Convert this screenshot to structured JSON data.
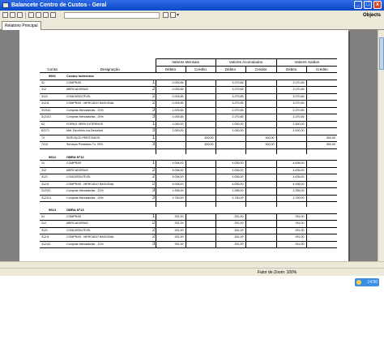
{
  "window": {
    "title": "Balancete Centro de Custos - Geral",
    "minimize": "_",
    "maximize": "□",
    "close": "x"
  },
  "toolbar": {
    "objects_label": "Objects",
    "dropdown_arrow": "▾"
  },
  "tabs": [
    {
      "label": "Relatório Principal"
    }
  ],
  "status": {
    "zoom": "Fator de Zoom: 100%"
  },
  "tray": {
    "time": "14:50"
  },
  "report": {
    "groups": {
      "mensais": "Valores Mensais",
      "acumulados": "Valores Acumulados",
      "saldos": "Valores Saldos"
    },
    "headers": {
      "conta": "Conta",
      "designacao": "Designação",
      "debito1": "Débito",
      "credito1": "Crédito",
      "debito2": "Débito",
      "credito2": "Crédito",
      "debito3": "Débito",
      "credito3": "Crédito"
    },
    "sections": [
      {
        "code": "9901",
        "name": "Custos Indirectos",
        "rows": [
          {
            "conta": "31",
            "desig": "COMPRAS",
            "n": "1",
            "d1": "2.005,65",
            "c1": "",
            "d2": "3.270,65",
            "c2": "",
            "d3": "3.270,65",
            "c3": ""
          },
          {
            "conta": "312",
            "desig": "MERCADORIAS",
            "n": "2",
            "d1": "2.005,65",
            "c1": "",
            "d2": "3.270,65",
            "c2": "",
            "d3": "3.270,65",
            "c3": ""
          },
          {
            "conta": "3121",
            "desig": "C/IVA DEDUTÍVEL",
            "n": "2",
            "d1": "2.005,65",
            "c1": "",
            "d2": "3.270,65",
            "c2": "",
            "d3": "3.270,65",
            "c3": ""
          },
          {
            "conta": "31211",
            "desig": "COMPRAS - MERCADO NACIONAL",
            "n": "2",
            "d1": "2.005,65",
            "c1": "",
            "d2": "3.270,65",
            "c2": "",
            "d3": "3.270,65",
            "c3": ""
          },
          {
            "conta": "312111",
            "desig": "Compras Mercadorias - 21%",
            "n": "3",
            "d1": "1.005,65",
            "c1": "",
            "d2": "2.270,65",
            "c2": "",
            "d3": "2.270,65",
            "c3": ""
          },
          {
            "conta": "312113",
            "desig": "Compras Mercadorias - 20%",
            "n": "3",
            "d1": "1.005,65",
            "c1": "",
            "d2": "2.270,65",
            "c2": "",
            "d3": "2.270,65",
            "c3": ""
          },
          {
            "conta": "62",
            "desig": "FORN E SERV EXTERNOS",
            "n": "1",
            "d1": "1.000,00",
            "c1": "",
            "d2": "1.000,00",
            "c2": "",
            "d3": "1.000,00",
            "c3": ""
          },
          {
            "conta": "62171",
            "desig": "Mat. Escritório-Iva Dedutível",
            "n": "3",
            "d1": "1.000,00",
            "c1": "",
            "d2": "1.000,00",
            "c2": "",
            "d3": "1.000,00",
            "c3": ""
          },
          {
            "conta": "72",
            "desig": "SERVIÇOS PRESTADOS",
            "n": "1",
            "d1": "",
            "c1": "500,00",
            "d2": "",
            "c2": "500,00",
            "d3": "",
            "c3": "500,00"
          },
          {
            "conta": "7213",
            "desig": "Serviços Prestados Tx. 20%",
            "n": "3",
            "d1": "",
            "c1": "500,00",
            "d2": "",
            "c2": "500,00",
            "d3": "",
            "c3": "500,00"
          }
        ]
      },
      {
        "code": "9912",
        "name": "OBRA Nº12",
        "rows": [
          {
            "conta": "31",
            "desig": "COMPRAS",
            "n": "1",
            "d1": "4.006,00",
            "c1": "",
            "d2": "4.006,00",
            "c2": "",
            "d3": "4.006,00",
            "c3": ""
          },
          {
            "conta": "312",
            "desig": "MERCADORIAS",
            "n": "2",
            "d1": "4.006,00",
            "c1": "",
            "d2": "4.006,00",
            "c2": "",
            "d3": "4.006,00",
            "c3": ""
          },
          {
            "conta": "3121",
            "desig": "C/IVA DEDUTÍVEL",
            "n": "2",
            "d1": "4.006,00",
            "c1": "",
            "d2": "4.006,00",
            "c2": "",
            "d3": "4.006,00",
            "c3": ""
          },
          {
            "conta": "31211",
            "desig": "COMPRAS - MERCADO NACIONAL",
            "n": "2",
            "d1": "4.006,00",
            "c1": "",
            "d2": "4.006,00",
            "c2": "",
            "d3": "4.006,00",
            "c3": ""
          },
          {
            "conta": "312111",
            "desig": "Compras Mercadorias - 21%",
            "n": "3",
            "d1": "1.256,00",
            "c1": "",
            "d2": "1.256,00",
            "c2": "",
            "d3": "1.256,00",
            "c3": ""
          },
          {
            "conta": "312113",
            "desig": "Compras Mercadorias - 20%",
            "n": "3",
            "d1": "2.750,00",
            "c1": "",
            "d2": "2.750,00",
            "c2": "",
            "d3": "2.750,00",
            "c3": ""
          }
        ]
      },
      {
        "code": "9913",
        "name": "OBRA Nº13",
        "rows": [
          {
            "conta": "31",
            "desig": "COMPRAS",
            "n": "1",
            "d1": "251,00",
            "c1": "",
            "d2": "251,00",
            "c2": "",
            "d3": "251,00",
            "c3": ""
          },
          {
            "conta": "312",
            "desig": "MERCADORIAS",
            "n": "2",
            "d1": "251,00",
            "c1": "",
            "d2": "251,00",
            "c2": "",
            "d3": "251,00",
            "c3": ""
          },
          {
            "conta": "3121",
            "desig": "C/IVA DEDUTÍVEL",
            "n": "2",
            "d1": "251,00",
            "c1": "",
            "d2": "251,00",
            "c2": "",
            "d3": "251,00",
            "c3": ""
          },
          {
            "conta": "31211",
            "desig": "COMPRAS - MERCADO NACIONAL",
            "n": "2",
            "d1": "251,00",
            "c1": "",
            "d2": "251,00",
            "c2": "",
            "d3": "251,00",
            "c3": ""
          },
          {
            "conta": "312111",
            "desig": "Compras Mercadorias - 21%",
            "n": "3",
            "d1": "251,00",
            "c1": "",
            "d2": "251,00",
            "c2": "",
            "d3": "251,00",
            "c3": ""
          }
        ]
      }
    ]
  }
}
